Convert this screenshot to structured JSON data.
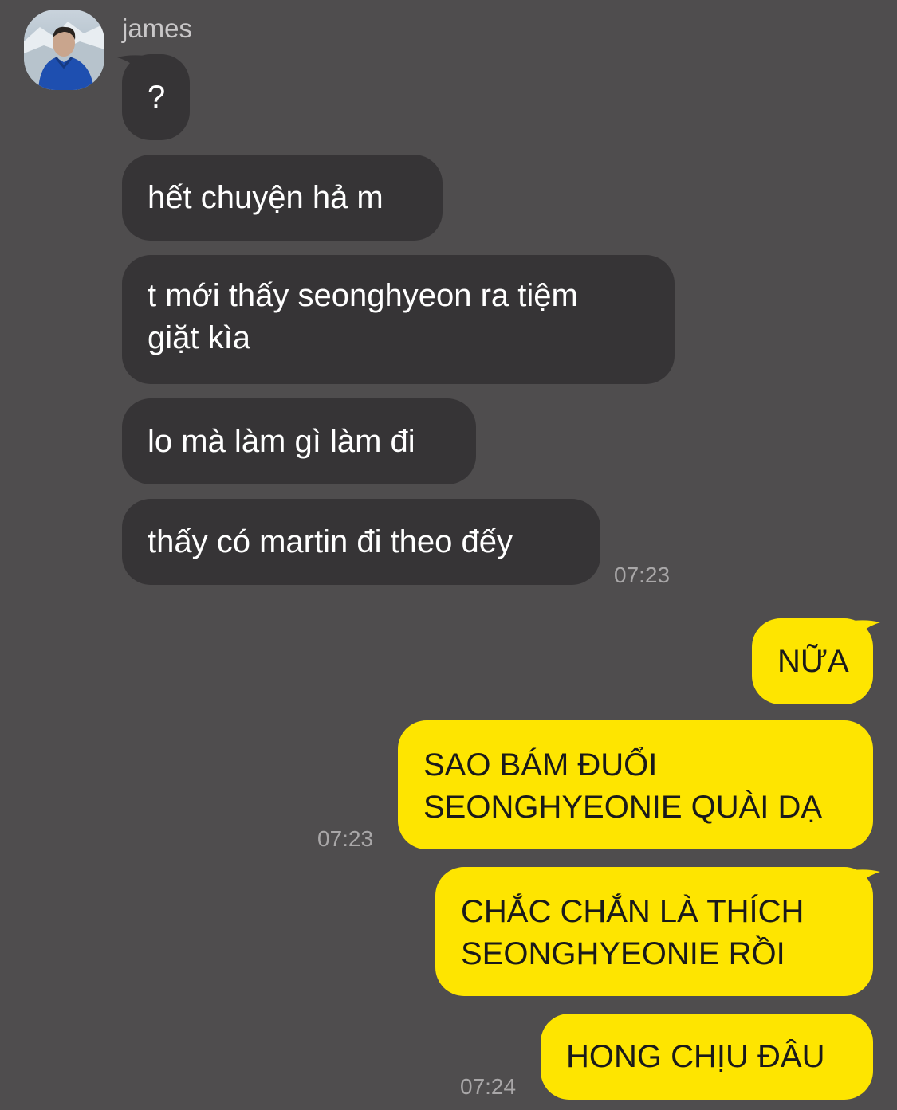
{
  "contact": {
    "name": "james",
    "avatar": "profile-photo"
  },
  "colors": {
    "background": "#4f4d4e",
    "incoming_bubble": "#363436",
    "outgoing_bubble": "#fee500"
  },
  "messages": {
    "incoming": [
      {
        "text": "?"
      },
      {
        "text": "hết chuyện hả m"
      },
      {
        "line1": "t mới thấy seonghyeon ra tiệm",
        "line2": "giặt kìa"
      },
      {
        "text": "lo mà làm gì làm đi"
      },
      {
        "text": "thấy có martin đi theo đếy"
      }
    ],
    "outgoing": [
      {
        "text": "NỮA"
      },
      {
        "line1": "SAO BÁM ĐUỔI",
        "line2": "SEONGHYEONIE QUÀI DẠ"
      },
      {
        "line1": "CHẮC CHẮN LÀ THÍCH",
        "line2": "SEONGHYEONIE RỒI"
      },
      {
        "text": "HONG CHỊU ĐÂU"
      }
    ]
  },
  "timestamps": {
    "incoming_group": "07:23",
    "outgoing_1": "07:23",
    "outgoing_2": "07:24"
  }
}
